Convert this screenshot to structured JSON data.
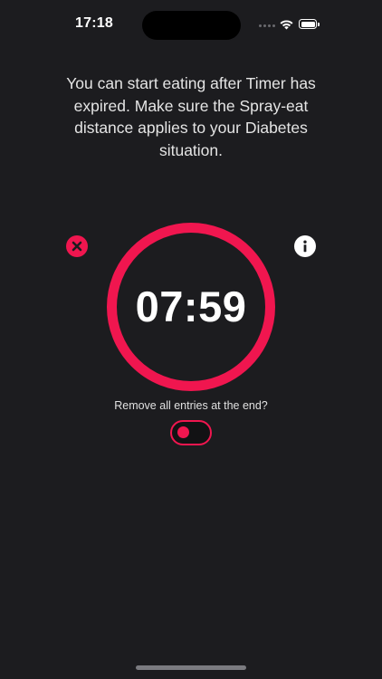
{
  "status_bar": {
    "time": "17:18"
  },
  "message": "You can start eating after Timer has expired. Make sure the Spray-eat distance applies to your Diabetes situation.",
  "timer": {
    "display": "07:59"
  },
  "toggle": {
    "label": "Remove all entries at the end?",
    "on": false
  },
  "icons": {
    "close": "close-icon",
    "info": "info-icon"
  },
  "colors": {
    "accent": "#f0164f",
    "background": "#1c1c1f",
    "text": "#e4e4e4"
  }
}
